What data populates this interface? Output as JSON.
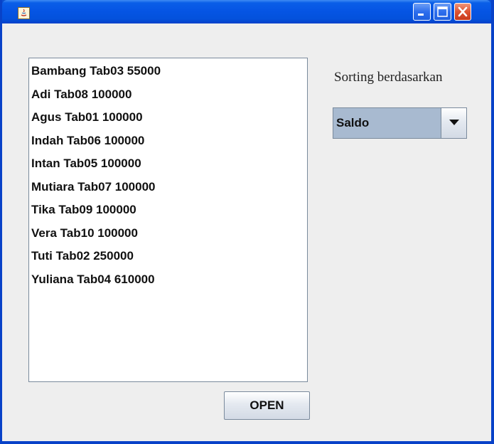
{
  "window": {
    "title": "",
    "titlebar_color": "#0a5ee8",
    "controls": [
      "minimize-icon",
      "maximize-icon",
      "close-icon"
    ]
  },
  "list": {
    "items": [
      "Bambang Tab03 55000",
      "Adi Tab08 100000",
      "Agus Tab01 100000",
      "Indah Tab06 100000",
      "Intan Tab05 100000",
      "Mutiara Tab07 100000",
      "Tika Tab09 100000",
      "Vera Tab10 100000",
      "Tuti Tab02 250000",
      "Yuliana Tab04 610000"
    ]
  },
  "sort": {
    "label": "Sorting berdasarkan",
    "selected": "Saldo"
  },
  "buttons": {
    "open_label": "OPEN"
  }
}
